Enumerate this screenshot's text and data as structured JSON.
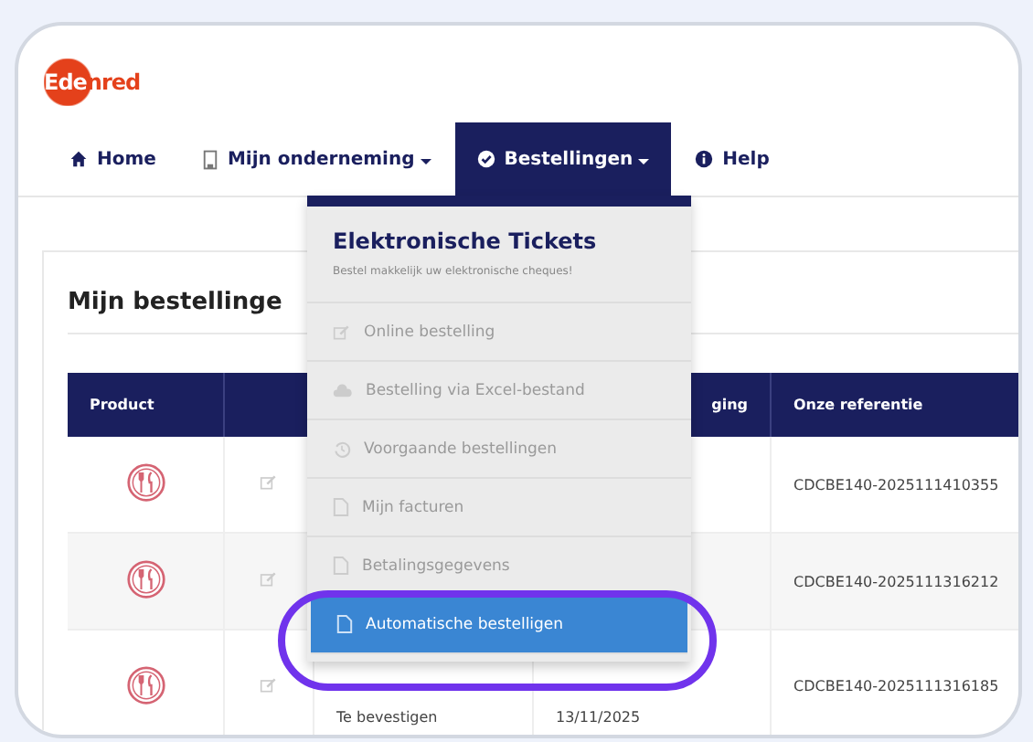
{
  "logo": {
    "text": "Edenred"
  },
  "nav": [
    {
      "label": "Home",
      "dropdown": false,
      "selected": false
    },
    {
      "label": "Mijn onderneming",
      "dropdown": true,
      "selected": false
    },
    {
      "label": "Bestellingen",
      "dropdown": true,
      "selected": true
    },
    {
      "label": "Help",
      "dropdown": false,
      "selected": false
    }
  ],
  "page_title": "Mijn bestellinge",
  "table": {
    "columns": [
      "Product",
      "",
      "",
      "ging",
      "Onze referentie"
    ],
    "rows": [
      {
        "cells": [
          "",
          "",
          "",
          "",
          "CDCBE140-2025111410355"
        ]
      },
      {
        "cells": [
          "",
          "",
          "",
          "",
          "CDCBE140-2025111316212"
        ]
      },
      {
        "cells": [
          "",
          "",
          "Te bevestigen",
          "13/11/2025",
          "CDCBE140-2025111316185"
        ]
      }
    ]
  },
  "menu": {
    "title": "Elektronische Tickets",
    "subtitle": "Bestel makkelijk uw elektronische cheques!",
    "items": [
      {
        "label": "Online bestelling",
        "selected": false
      },
      {
        "label": "Bestelling via Excel-bestand",
        "selected": false
      },
      {
        "label": "Voorgaande bestellingen",
        "selected": false
      },
      {
        "label": "Mijn facturen",
        "selected": false
      },
      {
        "label": "Betalingsgegevens",
        "selected": false
      },
      {
        "label": "Automatische bestelligen",
        "selected": true
      }
    ]
  },
  "highlight": {
    "shown": true
  }
}
